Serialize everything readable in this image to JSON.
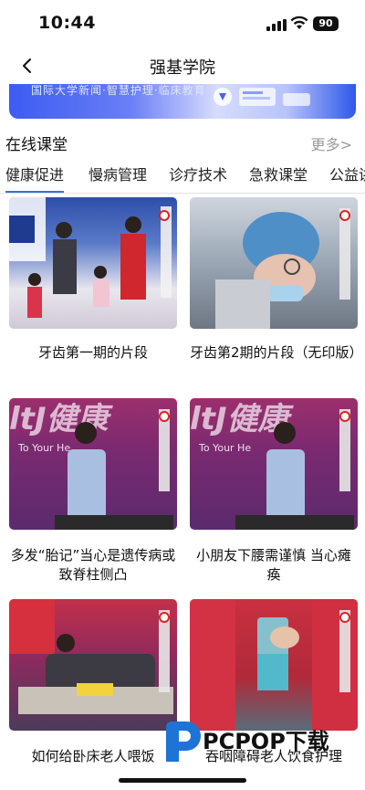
{
  "status": {
    "time": "10:44",
    "battery": "90"
  },
  "nav": {
    "title": "强基学院"
  },
  "banner": {
    "text": "国际大学新闻·智慧护理·临床教育"
  },
  "section": {
    "title": "在线课堂",
    "more": "更多>"
  },
  "tabs": [
    {
      "label": "健康促进",
      "active": true
    },
    {
      "label": "慢病管理",
      "active": false
    },
    {
      "label": "诊疗技术",
      "active": false
    },
    {
      "label": "急救课堂",
      "active": false
    },
    {
      "label": "公益讲",
      "active": false
    }
  ],
  "videos": [
    {
      "title": "牙齿第一期的片段"
    },
    {
      "title": "牙齿第2期的片段（无印版）"
    },
    {
      "title": "多发“胎记”当心是遗传病或致脊柱侧凸"
    },
    {
      "title": "小朋友下腰需谨慎 当心瘫痪"
    },
    {
      "title": "如何给卧床老人喂饭"
    },
    {
      "title": "吞咽障碍老人饮食护理"
    }
  ],
  "watermark": {
    "text": "PCPOP下载"
  },
  "colors": {
    "accent": "#3b6fd8",
    "more_text": "#9a9a9a"
  }
}
